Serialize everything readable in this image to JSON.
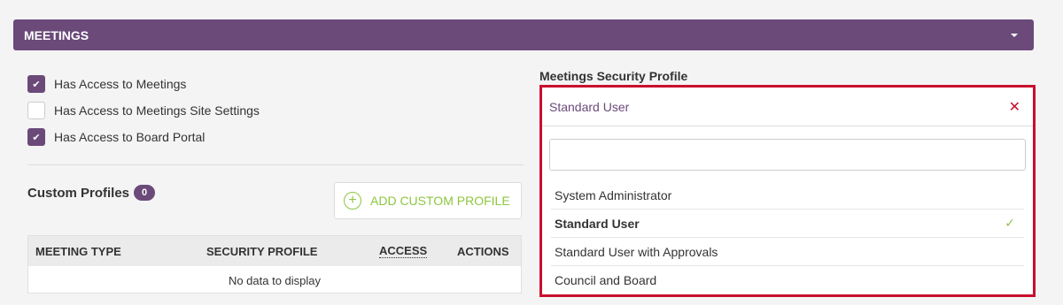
{
  "section": {
    "title": "MEETINGS",
    "toggle_icon": "caret-down-icon"
  },
  "checkboxes": [
    {
      "label": "Has Access to Meetings",
      "checked": true
    },
    {
      "label": "Has Access to Meetings Site Settings",
      "checked": false
    },
    {
      "label": "Has Access to Board Portal",
      "checked": true
    }
  ],
  "custom_profiles": {
    "title": "Custom Profiles",
    "count": "0",
    "add_button_label": "ADD CUSTOM PROFILE",
    "table": {
      "columns": [
        "MEETING TYPE",
        "SECURITY PROFILE",
        "ACCESS",
        "ACTIONS"
      ],
      "empty_text": "No data to display"
    }
  },
  "security_profile": {
    "label": "Meetings Security Profile",
    "selected_value": "Standard User",
    "search_value": "",
    "options": [
      {
        "label": "System Administrator",
        "selected": false
      },
      {
        "label": "Standard User",
        "selected": true
      },
      {
        "label": "Standard User with Approvals",
        "selected": false
      },
      {
        "label": "Council and Board",
        "selected": false
      }
    ]
  },
  "colors": {
    "brand_purple": "#6b4a7a",
    "accent_green": "#8dc63f",
    "highlight_red": "#c8102e"
  }
}
